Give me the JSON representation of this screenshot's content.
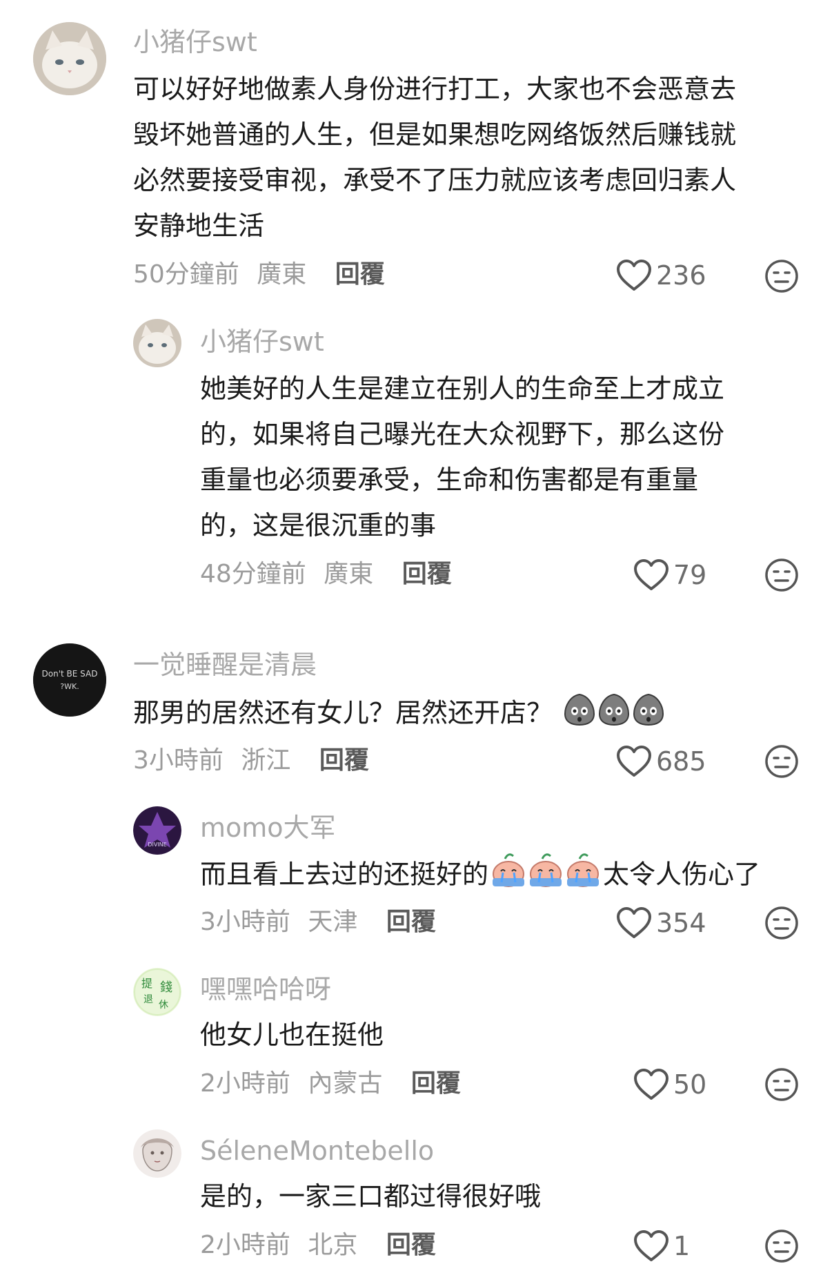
{
  "comments": [
    {
      "username": "小猪仔swt",
      "lines": [
        "可以好好地做素人身份进行打工，大家也不会恶意去",
        "毁坏她普通的人生，但是如果想吃网络饭然后赚钱就",
        "必然要接受审视，承受不了压力就应该考虑回归素人",
        "安静地生活"
      ],
      "time": "50分鐘前",
      "location": "廣東",
      "reply_label": "回覆",
      "likes": "236"
    },
    {
      "username": "小猪仔swt",
      "lines": [
        "她美好的人生是建立在别人的生命至上才成立",
        "的，如果将自己曝光在大众视野下，那么这份",
        "重量也必须要承受，生命和伤害都是有重量",
        "的，这是很沉重的事"
      ],
      "time": "48分鐘前",
      "location": "廣東",
      "reply_label": "回覆",
      "likes": "79"
    },
    {
      "username": "一觉睡醒是清晨",
      "lines": [
        "那男的居然还有女儿？居然还开店？"
      ],
      "time": "3小時前",
      "location": "浙江",
      "reply_label": "回覆",
      "likes": "685",
      "avatar_text": [
        "Don't BE SAD",
        "?WK."
      ]
    },
    {
      "username": "momo大军",
      "text_before": "而且看上去过的还挺好的",
      "text_after": "太令人伤心了",
      "time": "3小時前",
      "location": "天津",
      "reply_label": "回覆",
      "likes": "354",
      "avatar_text": "DIVINE"
    },
    {
      "username": "嘿嘿哈哈呀",
      "lines": [
        "他女儿也在挺他"
      ],
      "time": "2小時前",
      "location": "內蒙古",
      "reply_label": "回覆",
      "likes": "50",
      "avatar_text": [
        "提",
        "錢",
        "退",
        "休"
      ]
    },
    {
      "username": "SéleneMontebello",
      "lines": [
        "是的，一家三口都过得很好哦"
      ],
      "time": "2小時前",
      "location": "北京",
      "reply_label": "回覆",
      "likes": "1"
    }
  ],
  "icons": {
    "like": "heart-outline-icon",
    "dislike": "neutral-face-icon",
    "emoji_shock": "shocked-gourd-emoji",
    "emoji_cry": "crying-emoji"
  },
  "colors": {
    "username": "#a8a8a8",
    "text": "#1a1a1a",
    "meta": "#9b9b9b",
    "icon": "#555555"
  }
}
